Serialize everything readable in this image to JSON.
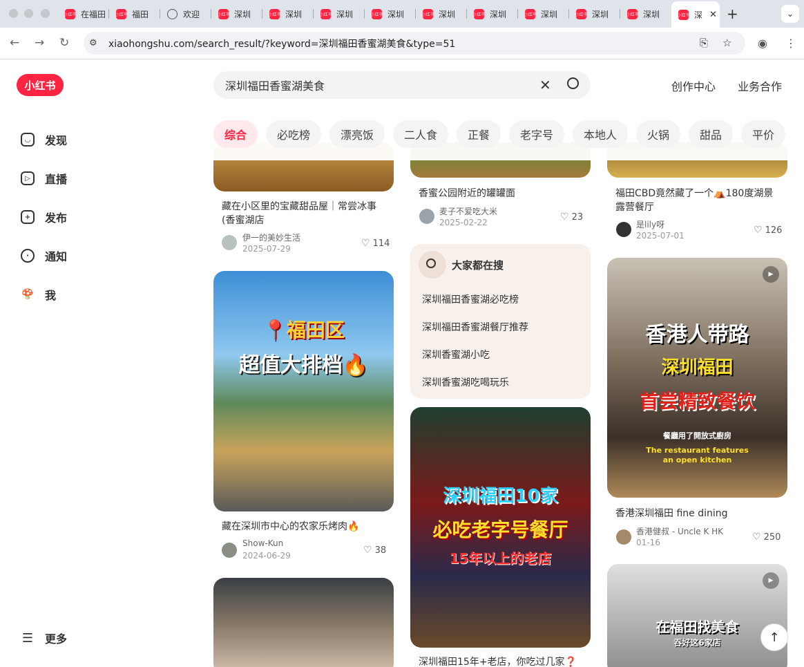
{
  "browser": {
    "tabs": [
      {
        "label": "在福田"
      },
      {
        "label": "福田"
      },
      {
        "label": "欢迎"
      },
      {
        "label": "深圳"
      },
      {
        "label": "深圳"
      },
      {
        "label": "深圳"
      },
      {
        "label": "深圳"
      },
      {
        "label": "深圳"
      },
      {
        "label": "深圳"
      },
      {
        "label": "深圳"
      },
      {
        "label": "深圳"
      },
      {
        "label": "深圳"
      },
      {
        "label": "深"
      }
    ],
    "favicon_text": "小红书",
    "url": "xiaohongshu.com/search_result/?keyword=深圳福田香蜜湖美食&type=51"
  },
  "app": {
    "logo": "小红书",
    "nav": [
      {
        "label": "发现",
        "icon": "home-icon"
      },
      {
        "label": "直播",
        "icon": "live-icon"
      },
      {
        "label": "发布",
        "icon": "plus-icon"
      },
      {
        "label": "通知",
        "icon": "bell-icon"
      },
      {
        "label": "我",
        "icon": "avatar-icon"
      }
    ],
    "more": "更多",
    "search": {
      "query": "深圳福田香蜜湖美食"
    },
    "top_links": [
      "创作中心",
      "业务合作"
    ],
    "filters": [
      "综合",
      "必吃榜",
      "漂亮饭",
      "二人食",
      "正餐",
      "老字号",
      "本地人",
      "火锅",
      "甜品",
      "平价"
    ],
    "active_filter": "综合"
  },
  "cards": [
    {
      "title": "藏在小区里的宝藏甜品屋｜常尝冰事(香蜜湖店",
      "author": "伊一的美妙生活",
      "date": "2025-07-29",
      "likes": "114"
    },
    {
      "title": "藏在深圳市中心的农家乐烤肉🔥",
      "author": "Show-Kun",
      "date": "2024-06-29",
      "likes": "38",
      "overlay": [
        "📍福田区",
        "超值大排档🔥"
      ]
    },
    {
      "title": "香蜜公园附近的罐罐面",
      "author": "麦子不爱吃大米",
      "date": "2025-02-22",
      "likes": "23"
    },
    {
      "title": "深圳福田15年+老店，你吃过几家❓",
      "overlay": [
        "深圳福田10家",
        "必吃老字号餐厅",
        "15年以上的老店"
      ]
    },
    {
      "title": "福田CBD竟然藏了一个⛺180度湖景露营餐厅",
      "author": "是lily呀",
      "date": "2025-07-01",
      "likes": "126"
    },
    {
      "title": "香港深圳福田 fine dining",
      "author": "香港健叔 - Uncle K HK",
      "date": "01-16",
      "likes": "250",
      "overlay": [
        "香港人带路",
        "深圳福田",
        "首尝精致餐饮",
        "餐廳用了開放式廚房",
        "The restaurant features",
        "an open kitchen"
      ]
    },
    {
      "overlay": [
        "在福田找美食",
        "吞好这6家店"
      ]
    }
  ],
  "hot_search": {
    "title": "大家都在搜",
    "items": [
      "深圳福田香蜜湖必吃榜",
      "深圳福田香蜜湖餐厅推荐",
      "深圳香蜜湖小吃",
      "深圳香蜜湖吃喝玩乐"
    ]
  },
  "colors": {
    "brand": "#ff2442"
  }
}
